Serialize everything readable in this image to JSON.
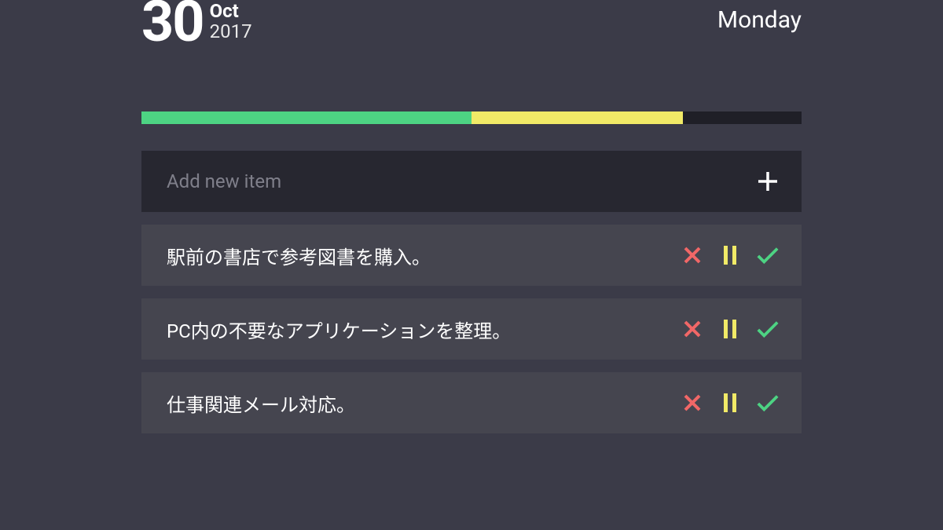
{
  "header": {
    "day": "30",
    "month": "Oct",
    "year": "2017",
    "weekday": "Monday"
  },
  "progress": {
    "green_pct": 50,
    "yellow_pct": 32
  },
  "add": {
    "placeholder": "Add new item"
  },
  "colors": {
    "green": "#4dd383",
    "yellow": "#f1ea67",
    "red": "#f16767"
  },
  "tasks": [
    {
      "text": "駅前の書店で参考図書を購入。"
    },
    {
      "text": "PC内の不要なアプリケーションを整理。"
    },
    {
      "text": "仕事関連メール対応。"
    }
  ]
}
